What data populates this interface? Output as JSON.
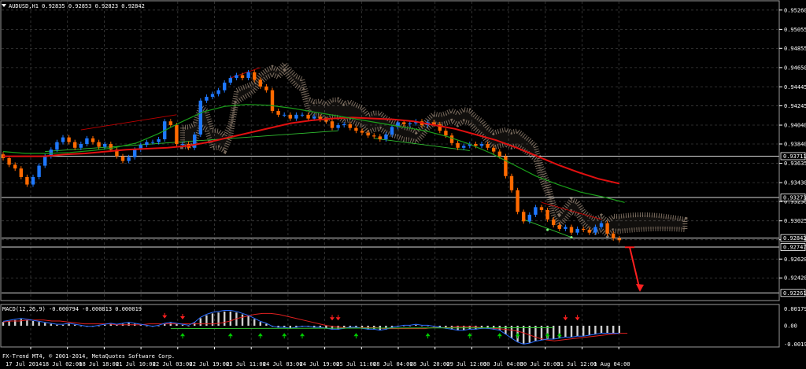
{
  "header": {
    "symbol_title": "AUDUSD,H1  0.92835 0.92853 0.92823 0.92842",
    "macd_title": "MACD(12,26,9) -0.000794 -0.000813 0.000019",
    "copyright": "FX-Trend MT4, © 2001-2014, MetaQuotes Software Corp."
  },
  "colors": {
    "background": "#000000",
    "grid": "#3c3c3c",
    "bull_candle": "#1e78ff",
    "bear_candle": "#ff6a00",
    "ma_red": "#e01010",
    "ma_green": "#1aa01a",
    "cloud": "#d8c0a8",
    "trendline": "#c00000",
    "macd_hist": "#d0d0d0",
    "arrow_up": "#00cc00",
    "arrow_down": "#ff2020"
  },
  "chart_data": [
    {
      "type": "candlestick",
      "symbol": "AUDUSD",
      "timeframe": "H1",
      "price_axis_labels": [
        "0.95260",
        "0.95055",
        "0.94855",
        "0.94650",
        "0.94445",
        "0.94245",
        "0.94040",
        "0.93840",
        "0.93635",
        "0.93430",
        "0.93230",
        "0.93025",
        "0.92825",
        "0.92620",
        "0.92420"
      ],
      "highlighted_levels": [
        "0.93711",
        "0.93273",
        "0.92842",
        "0.92747",
        "0.92261"
      ],
      "time_labels": [
        "17 Jul 2014",
        "18 Jul 02:00",
        "18 Jul 18:00",
        "21 Jul 10:00",
        "22 Jul 03:00",
        "22 Jul 19:00",
        "23 Jul 11:00",
        "24 Jul 03:00",
        "24 Jul 19:00",
        "25 Jul 11:00",
        "28 Jul 04:00",
        "28 Jul 20:00",
        "29 Jul 12:00",
        "30 Jul 04:00",
        "30 Jul 20:00",
        "31 Jul 12:00",
        "1 Aug 04:00"
      ],
      "ylim": [
        0.9218,
        0.9535
      ],
      "close_path": [
        0.9369,
        0.9362,
        0.9358,
        0.9349,
        0.9341,
        0.9349,
        0.9361,
        0.9371,
        0.9378,
        0.9386,
        0.9391,
        0.9386,
        0.938,
        0.9384,
        0.939,
        0.9386,
        0.9381,
        0.9384,
        0.9378,
        0.9371,
        0.9366,
        0.937,
        0.9378,
        0.9383,
        0.9386,
        0.9386,
        0.9389,
        0.9408,
        0.9404,
        0.9384,
        0.9384,
        0.938,
        0.9394,
        0.943,
        0.9434,
        0.9437,
        0.9441,
        0.9449,
        0.9454,
        0.9457,
        0.9454,
        0.946,
        0.9452,
        0.9445,
        0.9441,
        0.9419,
        0.9415,
        0.9415,
        0.9411,
        0.9415,
        0.9415,
        0.9411,
        0.9413,
        0.941,
        0.9408,
        0.9401,
        0.9404,
        0.9405,
        0.9401,
        0.9398,
        0.9396,
        0.9393,
        0.9392,
        0.9389,
        0.9394,
        0.9402,
        0.9407,
        0.9405,
        0.9406,
        0.9408,
        0.9404,
        0.9407,
        0.9405,
        0.9398,
        0.9393,
        0.9385,
        0.938,
        0.9382,
        0.9384,
        0.9382,
        0.9384,
        0.938,
        0.9376,
        0.9371,
        0.935,
        0.9335,
        0.9312,
        0.9302,
        0.9309,
        0.9317,
        0.9314,
        0.9304,
        0.9298,
        0.9294,
        0.9296,
        0.929,
        0.9294,
        0.9293,
        0.929,
        0.9296,
        0.93,
        0.9289,
        0.9284,
        0.9282
      ],
      "ma_red": [
        0.9371,
        0.9371,
        0.9371,
        0.9373,
        0.9374,
        0.9376,
        0.9378,
        0.9379,
        0.938,
        0.9382,
        0.9386,
        0.9391,
        0.9396,
        0.9401,
        0.9406,
        0.9409,
        0.9411,
        0.9412,
        0.9411,
        0.941,
        0.9408,
        0.9404,
        0.94,
        0.9394,
        0.9388,
        0.938,
        0.9371,
        0.9362,
        0.9354,
        0.9347,
        0.9342
      ],
      "ma_green": [
        0.9376,
        0.9374,
        0.9374,
        0.9375,
        0.9377,
        0.938,
        0.9385,
        0.9395,
        0.9407,
        0.9418,
        0.9424,
        0.9426,
        0.9425,
        0.9422,
        0.9418,
        0.9414,
        0.941,
        0.9406,
        0.9402,
        0.9398,
        0.9392,
        0.9384,
        0.9374,
        0.9362,
        0.935,
        0.9341,
        0.9333,
        0.9328,
        0.9322
      ]
    },
    {
      "type": "bar",
      "name": "MACD(12,26,9)",
      "axis_labels": [
        "0.001797",
        "0.00",
        "-0.001962"
      ],
      "ylim": [
        -0.00225,
        0.00225
      ],
      "histogram": [
        0.0004,
        0.0005,
        0.0006,
        0.0007,
        0.0006,
        0.0005,
        0.0004,
        0.0003,
        0.0002,
        0.0001,
        0.0001,
        0.0002,
        0.0001,
        0.0,
        -0.0001,
        -0.0001,
        0.0,
        0.0001,
        0.0002,
        0.0001,
        0.0002,
        0.0003,
        0.0002,
        0.0001,
        0.0,
        -0.0001,
        0.0,
        0.0002,
        0.0003,
        0.0002,
        0.0001,
        0.0,
        0.0003,
        0.0008,
        0.0011,
        0.0013,
        0.0014,
        0.0015,
        0.0015,
        0.0014,
        0.0012,
        0.001,
        0.0007,
        0.0004,
        0.0002,
        -0.0001,
        -0.0002,
        -0.0002,
        -0.0003,
        -0.0002,
        -0.0001,
        -0.0001,
        -0.0002,
        -0.0002,
        -0.0003,
        -0.0004,
        -0.0004,
        -0.0003,
        -0.0002,
        -0.0002,
        -0.0003,
        -0.0004,
        -0.0004,
        -0.0005,
        -0.0004,
        -0.0002,
        -0.0001,
        0.0,
        0.0,
        0.0001,
        0.0,
        0.0,
        -0.0001,
        -0.0002,
        -0.0003,
        -0.0004,
        -0.0005,
        -0.0005,
        -0.0004,
        -0.0004,
        -0.0003,
        -0.0003,
        -0.0004,
        -0.0005,
        -0.0009,
        -0.0013,
        -0.0017,
        -0.0019,
        -0.0018,
        -0.0016,
        -0.0015,
        -0.0014,
        -0.0014,
        -0.0013,
        -0.0012,
        -0.0012,
        -0.0011,
        -0.0011,
        -0.001,
        -0.0009,
        -0.0008,
        -0.0008,
        -0.0008,
        -0.0008
      ],
      "signal": [
        0.0004,
        0.0005,
        0.0005,
        0.0006,
        0.0006,
        0.0006,
        0.0005,
        0.0005,
        0.0004,
        0.0003,
        0.0002,
        0.0002,
        0.0002,
        0.0002,
        0.0001,
        0.0001,
        0.0001,
        0.0001,
        0.0002,
        0.0002,
        0.0002,
        0.0002,
        0.0002,
        0.0002,
        0.0002,
        0.0002,
        0.0002,
        0.0003,
        0.0005,
        0.0008,
        0.001,
        0.0012,
        0.0013,
        0.0013,
        0.0012,
        0.001,
        0.0008,
        0.0006,
        0.0004,
        0.0002,
        0.0,
        -0.0001,
        -0.0002,
        -0.0002,
        -0.0002,
        -0.0002,
        -0.0002,
        -0.0003,
        -0.0003,
        -0.0003,
        -0.0003,
        -0.0003,
        -0.0003,
        -0.0002,
        -0.0002,
        -0.0002,
        -0.0001,
        -0.0001,
        -0.0001,
        -0.0002,
        -0.0003,
        -0.0003,
        -0.0004,
        -0.0005,
        -0.0007,
        -0.001,
        -0.0013,
        -0.0015,
        -0.0016,
        -0.0015,
        -0.0014,
        -0.0013,
        -0.0012,
        -0.0011,
        -0.001,
        -0.0009,
        -0.0008,
        -0.0008
      ],
      "up_arrows_at": [
        30,
        38,
        43,
        47,
        50,
        59,
        71,
        78,
        83,
        86,
        91,
        93
      ],
      "down_arrows_at": [
        27,
        30,
        55,
        56,
        94,
        96
      ]
    }
  ]
}
